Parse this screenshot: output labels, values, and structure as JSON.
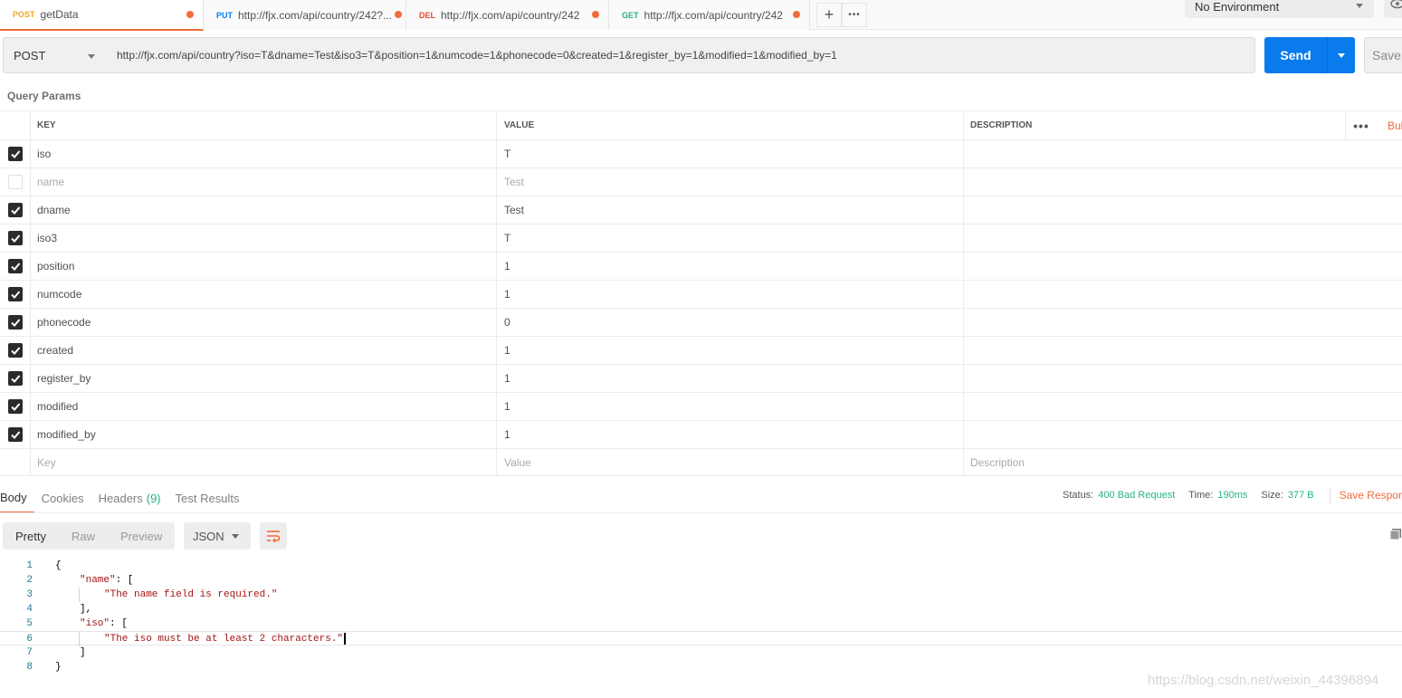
{
  "tabs": [
    {
      "method": "POST",
      "title": "getData",
      "method_color": "#f5a623"
    },
    {
      "method": "PUT",
      "title": "http://fjx.com/api/country/242?...",
      "method_color": "#097bed"
    },
    {
      "method": "DEL",
      "title": "http://fjx.com/api/country/242",
      "method_color": "#e8473b"
    },
    {
      "method": "GET",
      "title": "http://fjx.com/api/country/242",
      "method_color": "#26b47f"
    }
  ],
  "tab_actions": {
    "add": "+",
    "more": "•••"
  },
  "environment": {
    "selected": "No Environment"
  },
  "request": {
    "method": "POST",
    "url": "http://fjx.com/api/country?iso=T&dname=Test&iso3=T&position=1&numcode=1&phonecode=0&created=1&register_by=1&modified=1&modified_by=1",
    "send_label": "Send",
    "save_label": "Save"
  },
  "query_params": {
    "title": "Query Params",
    "headers": {
      "key": "KEY",
      "value": "VALUE",
      "description": "DESCRIPTION",
      "more": "•••",
      "bulk": "Bulk Edit"
    },
    "rows": [
      {
        "enabled": true,
        "key": "iso",
        "value": "T",
        "description": ""
      },
      {
        "enabled": false,
        "key": "name",
        "value": "Test",
        "description": ""
      },
      {
        "enabled": true,
        "key": "dname",
        "value": "Test",
        "description": ""
      },
      {
        "enabled": true,
        "key": "iso3",
        "value": "T",
        "description": ""
      },
      {
        "enabled": true,
        "key": "position",
        "value": "1",
        "description": ""
      },
      {
        "enabled": true,
        "key": "numcode",
        "value": "1",
        "description": ""
      },
      {
        "enabled": true,
        "key": "phonecode",
        "value": "0",
        "description": ""
      },
      {
        "enabled": true,
        "key": "created",
        "value": "1",
        "description": ""
      },
      {
        "enabled": true,
        "key": "register_by",
        "value": "1",
        "description": ""
      },
      {
        "enabled": true,
        "key": "modified",
        "value": "1",
        "description": ""
      },
      {
        "enabled": true,
        "key": "modified_by",
        "value": "1",
        "description": ""
      }
    ],
    "placeholder": {
      "key": "Key",
      "value": "Value",
      "description": "Description"
    }
  },
  "response": {
    "tabs": {
      "body": "Body",
      "cookies": "Cookies",
      "headers": "Headers",
      "headers_count": "(9)",
      "tests": "Test Results"
    },
    "status_label": "Status:",
    "status": "400 Bad Request",
    "time_label": "Time:",
    "time": "190ms",
    "size_label": "Size:",
    "size": "377 B",
    "save_response": "Save Response",
    "views": {
      "pretty": "Pretty",
      "raw": "Raw",
      "preview": "Preview"
    },
    "format": "JSON",
    "body_lines": [
      {
        "n": "1",
        "indent": 0,
        "parts": [
          {
            "t": "{",
            "c": "punct"
          }
        ]
      },
      {
        "n": "2",
        "indent": 1,
        "parts": [
          {
            "t": "\"name\"",
            "c": "key"
          },
          {
            "t": ": [",
            "c": "punct"
          }
        ]
      },
      {
        "n": "3",
        "indent": 2,
        "parts": [
          {
            "t": "\"The name field is required.\"",
            "c": "str"
          }
        ]
      },
      {
        "n": "4",
        "indent": 1,
        "parts": [
          {
            "t": "],",
            "c": "punct"
          }
        ]
      },
      {
        "n": "5",
        "indent": 1,
        "parts": [
          {
            "t": "\"iso\"",
            "c": "key"
          },
          {
            "t": ": [",
            "c": "punct"
          }
        ]
      },
      {
        "n": "6",
        "indent": 2,
        "parts": [
          {
            "t": "\"The iso must be at least 2 characters.\"",
            "c": "str"
          }
        ],
        "current": true
      },
      {
        "n": "7",
        "indent": 1,
        "parts": [
          {
            "t": "]",
            "c": "punct"
          }
        ]
      },
      {
        "n": "8",
        "indent": 0,
        "parts": [
          {
            "t": "}",
            "c": "punct"
          }
        ]
      }
    ]
  },
  "watermark": "https://blog.csdn.net/weixin_44396894",
  "colors": {
    "accent": "#f26b3a",
    "send": "#097bed",
    "status_ok_text": "#26b47f"
  },
  "icons": {
    "send_dropdown": "chevron-down-icon",
    "wrap": "wrap-lines-icon",
    "copy": "copy-icon",
    "checkbox": "check-icon",
    "eye": "eye-icon"
  }
}
